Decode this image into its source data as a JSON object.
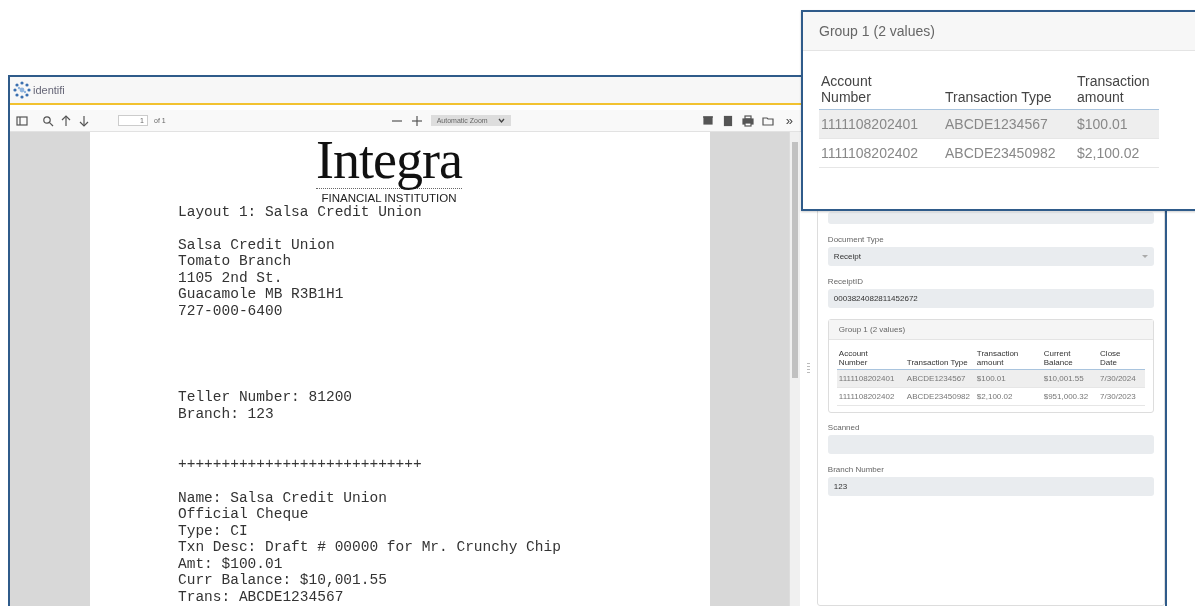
{
  "app": {
    "logo_text": "identifi"
  },
  "toolbar": {
    "page": "1",
    "page_count": "of 1",
    "zoom": "Automatic Zoom",
    "more": "»"
  },
  "document": {
    "logo": "Integra",
    "logo_subtitle": "FINANCIAL INSTITUTION",
    "blocks": [
      [
        "Layout 1: Salsa Credit Union"
      ],
      [
        "Salsa Credit Union",
        "Tomato Branch",
        "1105 2nd St.",
        "Guacamole MB R3B1H1",
        "727-000-6400"
      ],
      [
        "Teller Number: 81200",
        "Branch: 123"
      ],
      [
        "++++++++++++++++++++++++++++"
      ],
      [
        "Name: Salsa Credit Union",
        "Official Cheque",
        "Type: CI",
        "Txn Desc: Draft # 00000 for Mr. Crunchy Chip",
        "Amt: $100.01",
        "Curr Balance: $10,001.55",
        "Trans: ABCDE1234567"
      ]
    ]
  },
  "form": {
    "fields": [
      {
        "kind": "text"
      },
      {
        "kind": "select",
        "label": "Document Type",
        "value": "Receipt"
      },
      {
        "kind": "text",
        "label": "ReceiptID",
        "value": "0003824082811452672"
      },
      {
        "kind": "group",
        "title": "Group 1 (2 values)",
        "columns": [
          "Account Number",
          "Transaction Type",
          "Transaction amount",
          "Current Balance",
          "Close Date"
        ],
        "rows": [
          {
            "highlighted": true,
            "cells": [
              "1111108202401",
              "ABCDE1234567",
              "$100.01",
              "$10,001.55",
              "7/30/2024"
            ]
          },
          {
            "highlighted": false,
            "cells": [
              "1111108202402",
              "ABCDE23450982",
              "$2,100.02",
              "$951,000.32",
              "7/30/2023"
            ]
          }
        ]
      },
      {
        "kind": "text",
        "label": "Scanned"
      },
      {
        "kind": "text",
        "label": "Branch Number",
        "value": "123"
      }
    ]
  },
  "callout": {
    "title": "Group 1 (2 values)",
    "columns": [
      "Account Number",
      "Transaction Type",
      "Transaction amount"
    ],
    "rows": [
      {
        "highlighted": true,
        "cells": [
          "1111108202401",
          "ABCDE1234567",
          "$100.01"
        ]
      },
      {
        "highlighted": false,
        "cells": [
          "1111108202402",
          "ABCDE23450982",
          "$2,100.02"
        ]
      }
    ]
  }
}
